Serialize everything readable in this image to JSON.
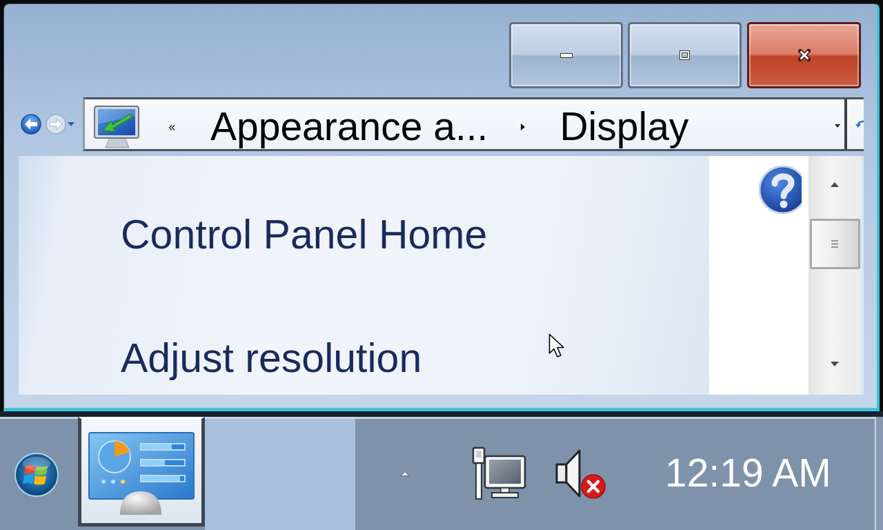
{
  "address_bar": {
    "crumbs": [
      {
        "label": "Appearance a..."
      },
      {
        "label": "Display"
      }
    ]
  },
  "nav_pane": {
    "links": [
      {
        "label": "Control Panel Home"
      },
      {
        "label": "Adjust resolution"
      }
    ]
  },
  "taskbar": {
    "apps": [
      {
        "selected": true
      }
    ],
    "clock": "12:19 AM"
  }
}
